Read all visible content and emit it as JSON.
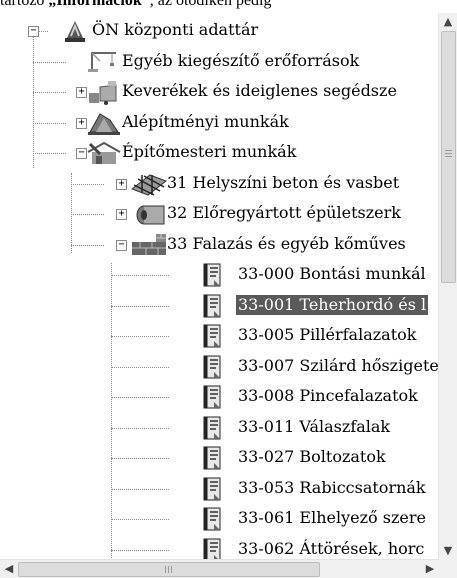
{
  "document": {
    "text_before": "tartozó ",
    "text_bold": "„Információk”",
    "text_after": ", az ötödiken pedig"
  },
  "tree": {
    "items": [
      {
        "label": "ÖN központi adattár",
        "level": 0,
        "expander": "minus",
        "icon": "database-icon"
      },
      {
        "label": "Egyéb kiegészítő erőforrások",
        "level": 1,
        "expander": "none",
        "icon": "crane-icon"
      },
      {
        "label": "Keverékek és ideiglenes segédsze",
        "level": 1,
        "expander": "plus",
        "icon": "mixer-icon"
      },
      {
        "label": "Alépítményi munkák",
        "level": 1,
        "expander": "plus",
        "icon": "foundation-icon"
      },
      {
        "label": "Építőmesteri munkák",
        "level": 1,
        "expander": "minus",
        "icon": "building-icon"
      },
      {
        "label": "31 Helyszíni beton és vasbet",
        "level": 2,
        "expander": "plus",
        "icon": "rebar-icon"
      },
      {
        "label": "32 Előregyártott épületszerk",
        "level": 2,
        "expander": "plus",
        "icon": "precast-icon"
      },
      {
        "label": "33 Falazás és egyéb kőműves",
        "level": 2,
        "expander": "minus",
        "icon": "bricks-icon"
      },
      {
        "label": "33-000 Bontási munkál",
        "level": 3,
        "expander": "none",
        "icon": "document-icon"
      },
      {
        "label": "33-001 Teherhordó és l",
        "level": 3,
        "expander": "none",
        "icon": "document-icon",
        "selected": true
      },
      {
        "label": "33-005 Pillérfalazatok",
        "level": 3,
        "expander": "none",
        "icon": "document-icon"
      },
      {
        "label": "33-007 Szilárd hőszigete",
        "level": 3,
        "expander": "none",
        "icon": "document-icon"
      },
      {
        "label": "33-008 Pincefalazatok",
        "level": 3,
        "expander": "none",
        "icon": "document-icon"
      },
      {
        "label": "33-011 Válaszfalak",
        "level": 3,
        "expander": "none",
        "icon": "document-icon"
      },
      {
        "label": "33-027 Boltozatok",
        "level": 3,
        "expander": "none",
        "icon": "document-icon"
      },
      {
        "label": "33-053 Rabiccsatornák",
        "level": 3,
        "expander": "none",
        "icon": "document-icon"
      },
      {
        "label": "33-061 Elhelyező szere",
        "level": 3,
        "expander": "none",
        "icon": "document-icon"
      },
      {
        "label": "33-062 Áttörések, horc",
        "level": 3,
        "expander": "none",
        "icon": "document-icon"
      }
    ]
  },
  "scrollbars": {
    "up_arrow": "▲",
    "down_arrow": "▼",
    "left_arrow": "◀",
    "right_arrow": "▶"
  },
  "colors": {
    "selection_bg": "#5a5a5a",
    "selection_text": "#ffffff",
    "tree_lines": "#888888"
  }
}
